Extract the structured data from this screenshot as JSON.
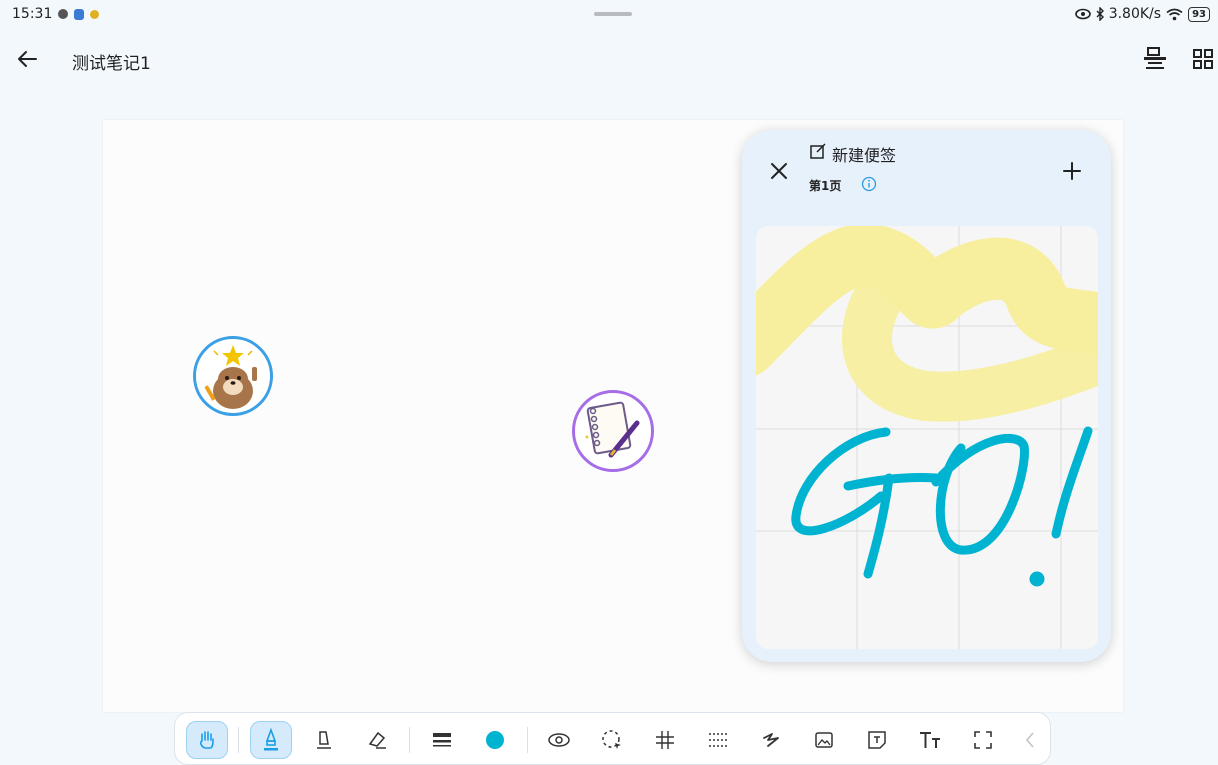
{
  "status_bar": {
    "time": "15:31",
    "network_speed": "3.80K/s",
    "battery": "93"
  },
  "header": {
    "title": "测试笔记1"
  },
  "sticky_note": {
    "title": "新建便签",
    "page_label": "第1页",
    "handwriting": "GO!"
  },
  "colors": {
    "accent": "#1a9ee8",
    "pen_color": "#00b3d1",
    "highlighter": "#f7ee9e"
  },
  "toolbar": {
    "tools": [
      "hand-icon",
      "pen-icon",
      "pencil-icon",
      "eraser-icon",
      "stroke-width-icon",
      "color-swatch",
      "eye-icon",
      "lasso-icon",
      "grid-icon",
      "dotted-grid-icon",
      "shape-icon",
      "image-icon",
      "sticky-note-icon",
      "text-icon",
      "fullscreen-icon",
      "more-icon"
    ]
  }
}
